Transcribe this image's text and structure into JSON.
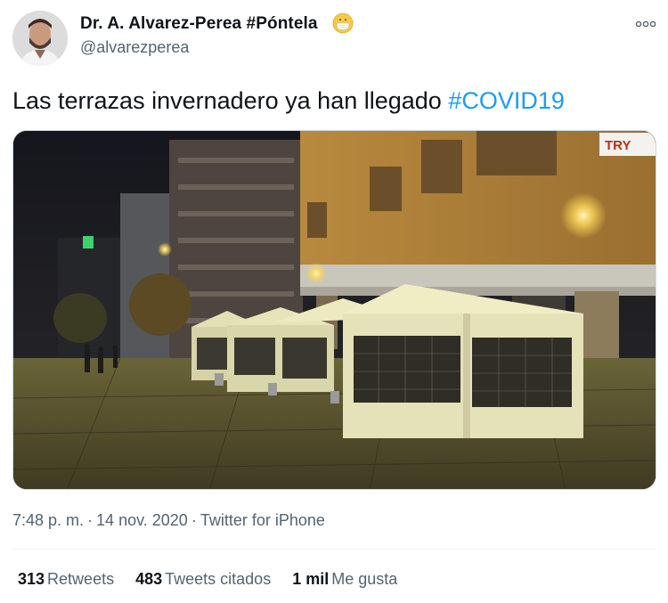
{
  "user": {
    "display_name": "Dr. A. Alvarez-Perea #Póntela",
    "handle": "@alvarezperea"
  },
  "tweet": {
    "text": "Las terrazas invernadero ya han llegado ",
    "hashtag": "#COVID19",
    "photo_sign_text": "TRY"
  },
  "meta": {
    "time": "7:48 p. m.",
    "separator": "·",
    "date": "14 nov. 2020",
    "source": "Twitter for iPhone"
  },
  "stats": {
    "retweets_count": "313",
    "retweets_label": "Retweets",
    "quotes_count": "483",
    "quotes_label": "Tweets citados",
    "likes_count": "1 mil",
    "likes_label": "Me gusta"
  },
  "icons": {
    "more": "more-dots-icon",
    "emoji": "face-with-mask-emoji"
  },
  "colors": {
    "accent": "#1d9bf0",
    "secondary_text": "#536471",
    "primary_text": "#0f1419"
  }
}
